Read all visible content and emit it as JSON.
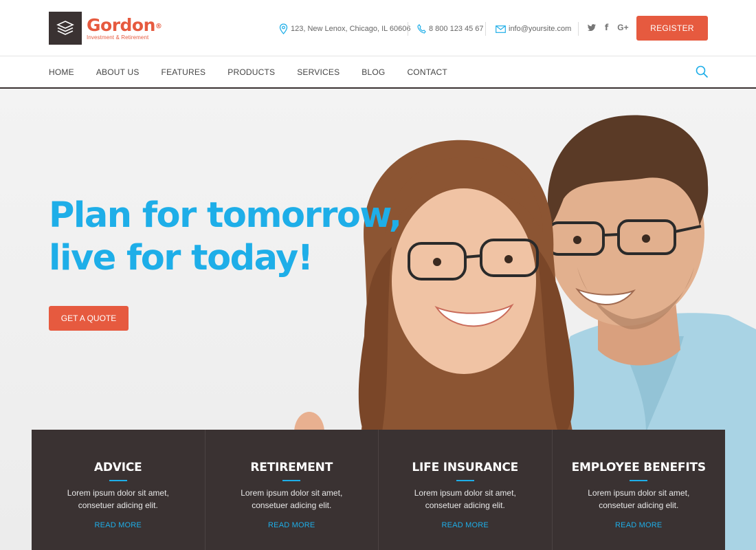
{
  "brand": {
    "name": "Gordon",
    "registered": "®",
    "tagline": "Investment & Retirement",
    "color": "#e65a3f"
  },
  "contact": {
    "address": "123, New Lenox, Chicago, IL 60606",
    "phone": "8 800 123 45 67",
    "email": "info@yoursite.com"
  },
  "social": [
    "twitter-icon",
    "facebook-icon",
    "google-plus-icon"
  ],
  "social_labels": {
    "google": "G+",
    "facebook": "f"
  },
  "header": {
    "register_label": "REGISTER"
  },
  "nav": {
    "items": [
      "HOME",
      "ABOUT US",
      "FEATURES",
      "PRODUCTS",
      "SERVICES",
      "BLOG",
      "CONTACT"
    ]
  },
  "hero": {
    "line1": "Plan for tomorrow,",
    "line2": "live for today!",
    "cta": "GET A QUOTE",
    "accent": "#1eaee8"
  },
  "features": [
    {
      "title": "ADVICE",
      "text1": "Lorem ipsum dolor sit amet,",
      "text2": "consetuer adicing elit.",
      "link": "READ MORE"
    },
    {
      "title": "RETIREMENT",
      "text1": "Lorem ipsum dolor sit amet,",
      "text2": "consetuer adicing elit.",
      "link": "READ MORE"
    },
    {
      "title": "LIFE INSURANCE",
      "text1": "Lorem ipsum dolor sit amet,",
      "text2": "consetuer adicing elit.",
      "link": "READ MORE"
    },
    {
      "title": "EMPLOYEE BENEFITS",
      "text1": "Lorem ipsum dolor sit amet,",
      "text2": "consetuer adicing elit.",
      "link": "READ MORE"
    }
  ]
}
